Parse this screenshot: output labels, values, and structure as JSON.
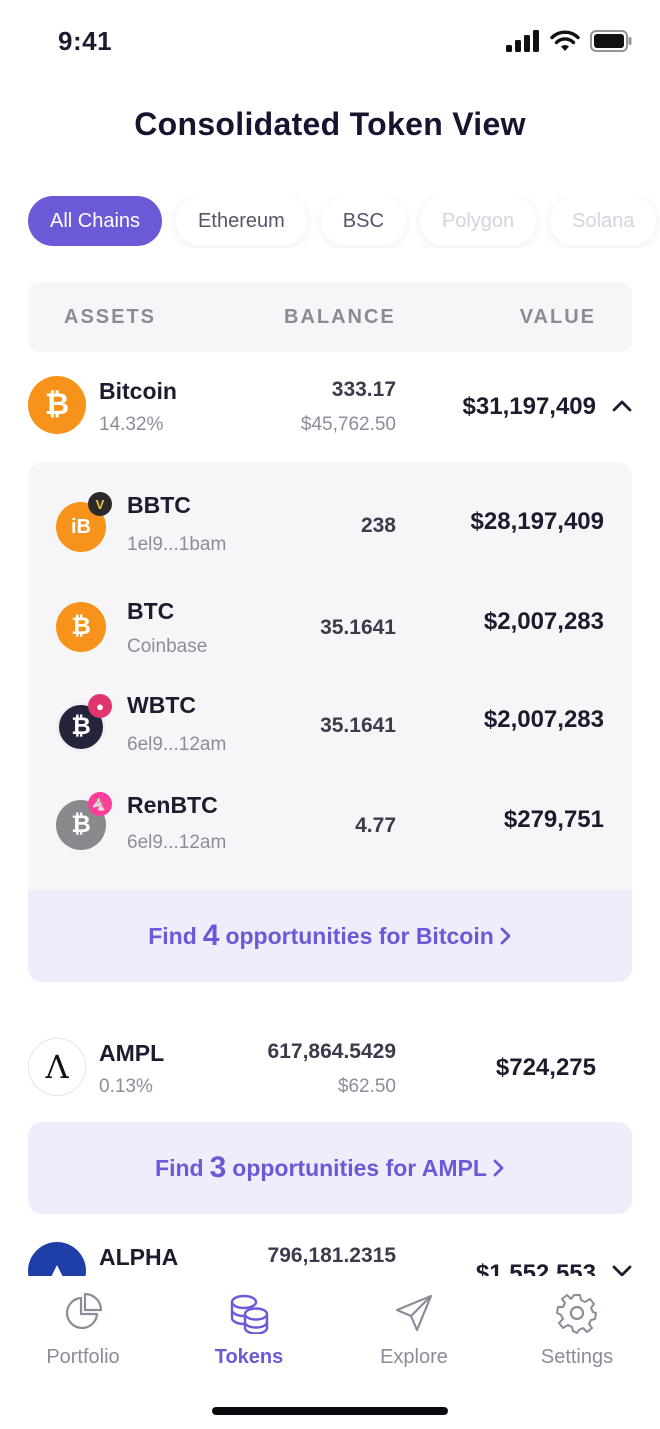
{
  "status_bar": {
    "time": "9:41"
  },
  "page_title": "Consolidated Token View",
  "chips": [
    {
      "label": "All Chains",
      "active": true
    },
    {
      "label": "Ethereum",
      "active": false
    },
    {
      "label": "BSC",
      "active": false
    },
    {
      "label": "Polygon",
      "active": false
    },
    {
      "label": "Solana",
      "active": false
    }
  ],
  "table_header": {
    "assets": "ASSETS",
    "balance": "BALANCE",
    "value": "VALUE"
  },
  "bitcoin": {
    "name": "Bitcoin",
    "percent": "14.32%",
    "balance": "333.17",
    "price": "$45,762.50",
    "value": "$31,197,409",
    "children": [
      {
        "name": "BBTC",
        "sub": "1el9...1bam",
        "balance": "238",
        "value": "$28,197,409"
      },
      {
        "name": "BTC",
        "sub": "Coinbase",
        "balance": "35.1641",
        "value": "$2,007,283"
      },
      {
        "name": "WBTC",
        "sub": "6el9...12am",
        "balance": "35.1641",
        "value": "$2,007,283"
      },
      {
        "name": "RenBTC",
        "sub": "6el9...12am",
        "balance": "4.77",
        "value": "$279,751"
      }
    ],
    "opportunity": {
      "prefix": "Find",
      "count": "4",
      "suffix": "opportunities for Bitcoin"
    }
  },
  "ampl": {
    "name": "AMPL",
    "percent": "0.13%",
    "balance": "617,864.5429",
    "price": "$62.50",
    "value": "$724,275",
    "opportunity": {
      "prefix": "Find",
      "count": "3",
      "suffix": "opportunities for AMPL"
    }
  },
  "alpha": {
    "name": "ALPHA",
    "balance": "796,181.2315",
    "value": "$1,552,553"
  },
  "tabs": [
    {
      "label": "Portfolio",
      "active": false
    },
    {
      "label": "Tokens",
      "active": true
    },
    {
      "label": "Explore",
      "active": false
    },
    {
      "label": "Settings",
      "active": false
    }
  ],
  "colors": {
    "accent": "#6a5ad8",
    "bitcoin_orange": "#f7931a",
    "opportunity_bg": "#efecfb"
  }
}
